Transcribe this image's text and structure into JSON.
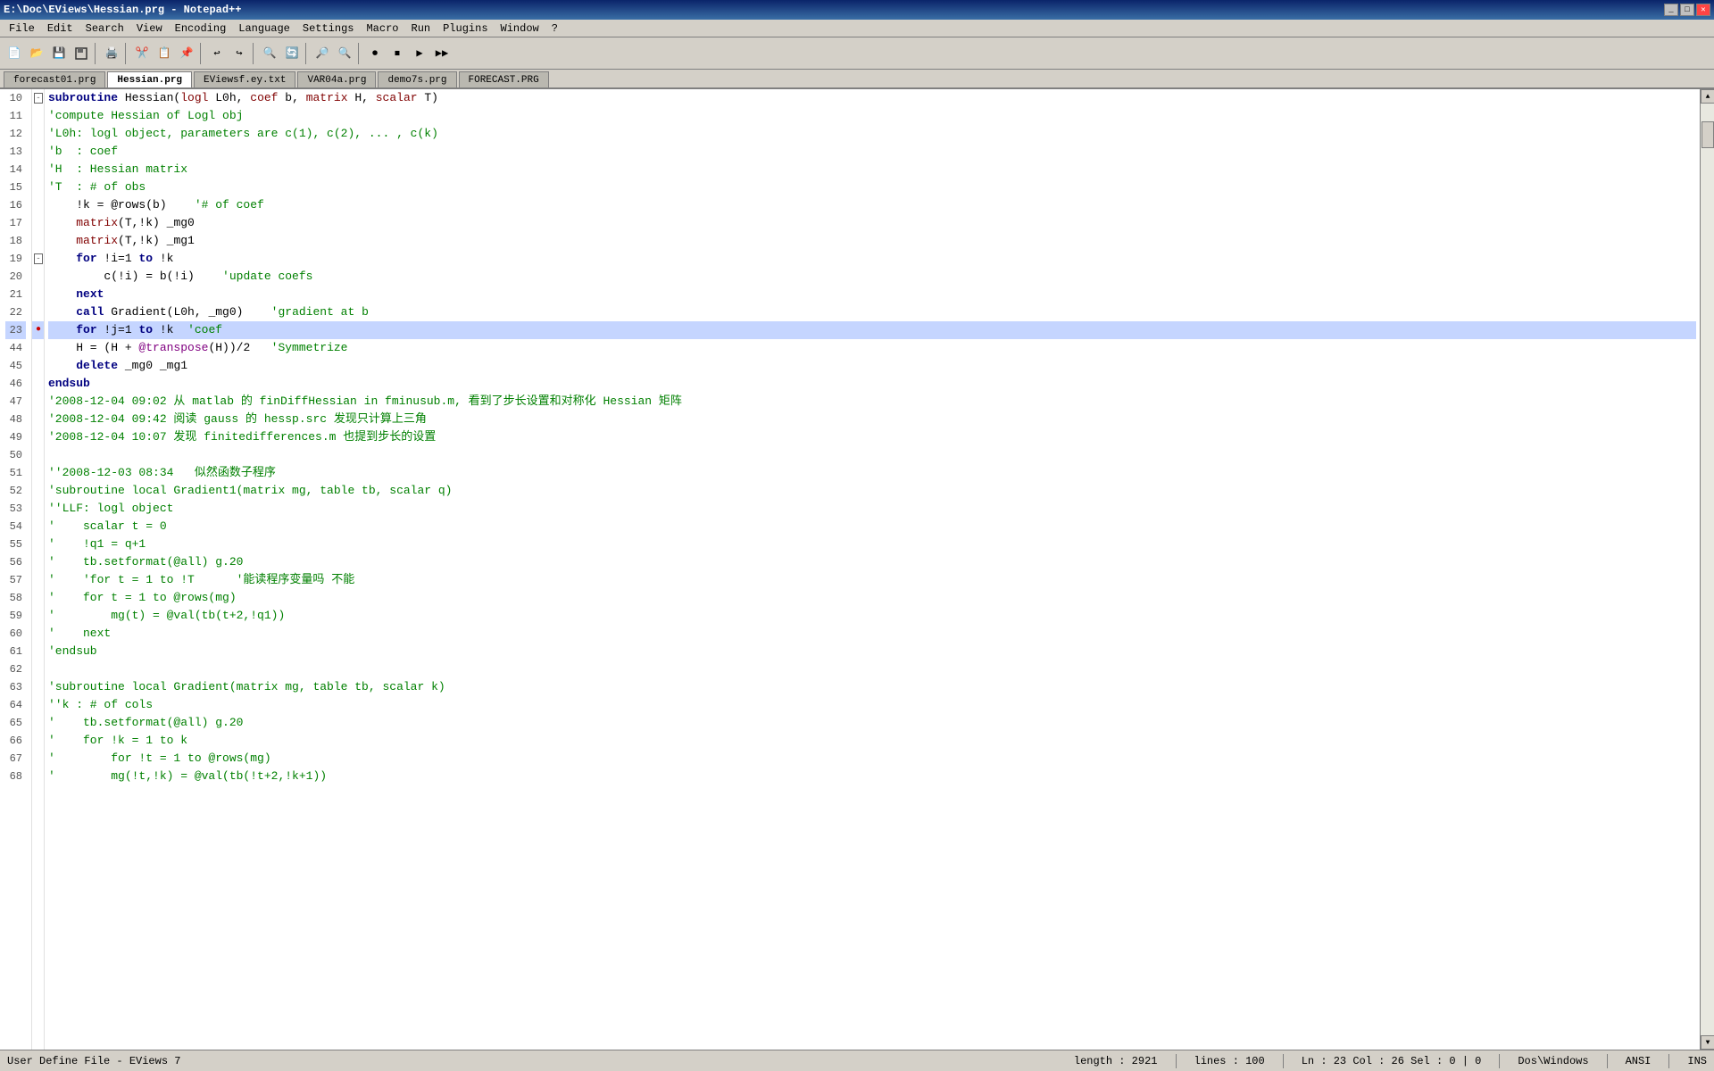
{
  "titleBar": {
    "text": "E:\\Doc\\EViews\\Hessian.prg - Notepad++",
    "controls": [
      "_",
      "□",
      "✕"
    ]
  },
  "menuBar": {
    "items": [
      "File",
      "Edit",
      "Search",
      "View",
      "Encoding",
      "Language",
      "Settings",
      "Macro",
      "Run",
      "Plugins",
      "Window",
      "?"
    ]
  },
  "tabs": [
    {
      "label": "forecast01.prg",
      "active": false
    },
    {
      "label": "Hessian.prg",
      "active": true
    },
    {
      "label": "EViewsf.ey.txt",
      "active": false
    },
    {
      "label": "VAR04a.prg",
      "active": false
    },
    {
      "label": "demo7s.prg",
      "active": false
    },
    {
      "label": "FORECAST.PRG",
      "active": false
    }
  ],
  "statusBar": {
    "left": "User Define File - EViews 7",
    "length": "length : 2921",
    "lines": "lines : 100",
    "position": "Ln : 23   Col : 26   Sel : 0 | 0",
    "dosWindows": "Dos\\Windows",
    "ansi": "ANSI",
    "ins": "INS"
  },
  "lines": [
    {
      "num": 10,
      "fold": "□",
      "highlight": false,
      "tokens": [
        {
          "t": "subroutine",
          "c": "kw"
        },
        {
          "t": " Hessian(",
          "c": "var"
        },
        {
          "t": "logl",
          "c": "type"
        },
        {
          "t": " L0h, ",
          "c": "var"
        },
        {
          "t": "coef",
          "c": "type"
        },
        {
          "t": " b, ",
          "c": "var"
        },
        {
          "t": "matrix",
          "c": "type"
        },
        {
          "t": " H, ",
          "c": "var"
        },
        {
          "t": "scalar",
          "c": "type"
        },
        {
          "t": " T)",
          "c": "var"
        }
      ]
    },
    {
      "num": 11,
      "fold": "",
      "highlight": false,
      "tokens": [
        {
          "t": "'compute Hessian of Logl obj",
          "c": "comment"
        }
      ]
    },
    {
      "num": 12,
      "fold": "",
      "highlight": false,
      "tokens": [
        {
          "t": "'L0h: logl object, parameters are c(1), c(2), ... , c(k)",
          "c": "comment"
        }
      ]
    },
    {
      "num": 13,
      "fold": "",
      "highlight": false,
      "tokens": [
        {
          "t": "'b  : coef",
          "c": "comment"
        }
      ]
    },
    {
      "num": 14,
      "fold": "",
      "highlight": false,
      "tokens": [
        {
          "t": "'H  : Hessian matrix",
          "c": "comment"
        }
      ]
    },
    {
      "num": 15,
      "fold": "",
      "highlight": false,
      "tokens": [
        {
          "t": "'T  : # of obs",
          "c": "comment"
        }
      ]
    },
    {
      "num": 16,
      "fold": "",
      "highlight": false,
      "tokens": [
        {
          "t": "    !k = @rows(b)    ",
          "c": "var"
        },
        {
          "t": "'# of coef",
          "c": "comment"
        }
      ]
    },
    {
      "num": 17,
      "fold": "",
      "highlight": false,
      "tokens": [
        {
          "t": "    ",
          "c": "var"
        },
        {
          "t": "matrix",
          "c": "type"
        },
        {
          "t": "(T,!k) _mg0",
          "c": "var"
        }
      ]
    },
    {
      "num": 18,
      "fold": "",
      "highlight": false,
      "tokens": [
        {
          "t": "    ",
          "c": "var"
        },
        {
          "t": "matrix",
          "c": "type"
        },
        {
          "t": "(T,!k) _mg1",
          "c": "var"
        }
      ]
    },
    {
      "num": 19,
      "fold": "□",
      "highlight": false,
      "tokens": [
        {
          "t": "    ",
          "c": "var"
        },
        {
          "t": "for",
          "c": "kw"
        },
        {
          "t": " !i=1 ",
          "c": "var"
        },
        {
          "t": "to",
          "c": "kw"
        },
        {
          "t": " !k",
          "c": "var"
        }
      ]
    },
    {
      "num": 20,
      "fold": "",
      "highlight": false,
      "tokens": [
        {
          "t": "        c(!i) = b(!i)    ",
          "c": "var"
        },
        {
          "t": "'update coefs",
          "c": "comment"
        }
      ]
    },
    {
      "num": 21,
      "fold": "",
      "highlight": false,
      "tokens": [
        {
          "t": "    ",
          "c": "var"
        },
        {
          "t": "next",
          "c": "kw"
        }
      ]
    },
    {
      "num": 22,
      "fold": "",
      "highlight": false,
      "tokens": [
        {
          "t": "    ",
          "c": "var"
        },
        {
          "t": "call",
          "c": "kw"
        },
        {
          "t": " Gradient(L0h, _mg0)    ",
          "c": "var"
        },
        {
          "t": "'gradient at b",
          "c": "comment"
        }
      ]
    },
    {
      "num": 23,
      "fold": "●",
      "highlight": true,
      "tokens": [
        {
          "t": "    ",
          "c": "var"
        },
        {
          "t": "for",
          "c": "kw"
        },
        {
          "t": " !j=1 ",
          "c": "var"
        },
        {
          "t": "to",
          "c": "kw"
        },
        {
          "t": " !k  ",
          "c": "var"
        },
        {
          "t": "'coef",
          "c": "comment"
        }
      ]
    },
    {
      "num": 44,
      "fold": "",
      "highlight": false,
      "tokens": [
        {
          "t": "    H = (H + ",
          "c": "var"
        },
        {
          "t": "@transpose",
          "c": "at"
        },
        {
          "t": "(H))/2   ",
          "c": "var"
        },
        {
          "t": "'Symmetrize",
          "c": "comment"
        }
      ]
    },
    {
      "num": 45,
      "fold": "",
      "highlight": false,
      "tokens": [
        {
          "t": "    ",
          "c": "var"
        },
        {
          "t": "delete",
          "c": "kw"
        },
        {
          "t": " _mg0 _mg1",
          "c": "var"
        }
      ]
    },
    {
      "num": 46,
      "fold": "",
      "highlight": false,
      "tokens": [
        {
          "t": "endsub",
          "c": "kw"
        }
      ]
    },
    {
      "num": 47,
      "fold": "",
      "highlight": false,
      "tokens": [
        {
          "t": "'2008-12-04 09:02 从 matlab 的 finDiffHessian in fminusub.m, 看到了步长设置和对称化 Hessian 矩阵",
          "c": "comment"
        }
      ]
    },
    {
      "num": 48,
      "fold": "",
      "highlight": false,
      "tokens": [
        {
          "t": "'2008-12-04 09:42 阅读 gauss 的 hessp.src 发现只计算上三角",
          "c": "comment"
        }
      ]
    },
    {
      "num": 49,
      "fold": "",
      "highlight": false,
      "tokens": [
        {
          "t": "'2008-12-04 10:07 发现 finitedifferences.m 也提到步长的设置",
          "c": "comment"
        }
      ]
    },
    {
      "num": 50,
      "fold": "",
      "highlight": false,
      "tokens": [
        {
          "t": "",
          "c": "var"
        }
      ]
    },
    {
      "num": 51,
      "fold": "",
      "highlight": false,
      "tokens": [
        {
          "t": "''2008-12-03 08:34   似然函数子程序",
          "c": "comment"
        }
      ]
    },
    {
      "num": 52,
      "fold": "",
      "highlight": false,
      "tokens": [
        {
          "t": "'subroutine local Gradient1(matrix mg, table tb, scalar q)",
          "c": "comment"
        }
      ]
    },
    {
      "num": 53,
      "fold": "",
      "highlight": false,
      "tokens": [
        {
          "t": "''LLF: logl object",
          "c": "comment"
        }
      ]
    },
    {
      "num": 54,
      "fold": "",
      "highlight": false,
      "tokens": [
        {
          "t": "'    scalar t = 0",
          "c": "comment"
        }
      ]
    },
    {
      "num": 55,
      "fold": "",
      "highlight": false,
      "tokens": [
        {
          "t": "'    !q1 = q+1",
          "c": "comment"
        }
      ]
    },
    {
      "num": 56,
      "fold": "",
      "highlight": false,
      "tokens": [
        {
          "t": "'    tb.setformat(@all) g.20",
          "c": "comment"
        }
      ]
    },
    {
      "num": 57,
      "fold": "",
      "highlight": false,
      "tokens": [
        {
          "t": "'    'for t = 1 to !T      '能读程序变量吗 不能",
          "c": "comment"
        }
      ]
    },
    {
      "num": 58,
      "fold": "",
      "highlight": false,
      "tokens": [
        {
          "t": "'    for t = 1 to @rows(mg)",
          "c": "comment"
        }
      ]
    },
    {
      "num": 59,
      "fold": "",
      "highlight": false,
      "tokens": [
        {
          "t": "'        mg(t) = @val(tb(t+2,!q1))",
          "c": "comment"
        }
      ]
    },
    {
      "num": 60,
      "fold": "",
      "highlight": false,
      "tokens": [
        {
          "t": "'    next",
          "c": "comment"
        }
      ]
    },
    {
      "num": 61,
      "fold": "",
      "highlight": false,
      "tokens": [
        {
          "t": "'endsub",
          "c": "comment"
        }
      ]
    },
    {
      "num": 62,
      "fold": "",
      "highlight": false,
      "tokens": [
        {
          "t": "",
          "c": "var"
        }
      ]
    },
    {
      "num": 63,
      "fold": "",
      "highlight": false,
      "tokens": [
        {
          "t": "'subroutine local Gradient(matrix mg, table tb, scalar k)",
          "c": "comment"
        }
      ]
    },
    {
      "num": 64,
      "fold": "",
      "highlight": false,
      "tokens": [
        {
          "t": "''k : # of cols",
          "c": "comment"
        }
      ]
    },
    {
      "num": 65,
      "fold": "",
      "highlight": false,
      "tokens": [
        {
          "t": "'    tb.setformat(@all) g.20",
          "c": "comment"
        }
      ]
    },
    {
      "num": 66,
      "fold": "",
      "highlight": false,
      "tokens": [
        {
          "t": "'    for !k = 1 to k",
          "c": "comment"
        }
      ]
    },
    {
      "num": 67,
      "fold": "",
      "highlight": false,
      "tokens": [
        {
          "t": "'        for !t = 1 to @rows(mg)",
          "c": "comment"
        }
      ]
    },
    {
      "num": 68,
      "fold": "",
      "highlight": false,
      "tokens": [
        {
          "t": "'        mg(!t,!k) = @val(tb(!t+2,!k+1))",
          "c": "comment"
        }
      ]
    }
  ]
}
